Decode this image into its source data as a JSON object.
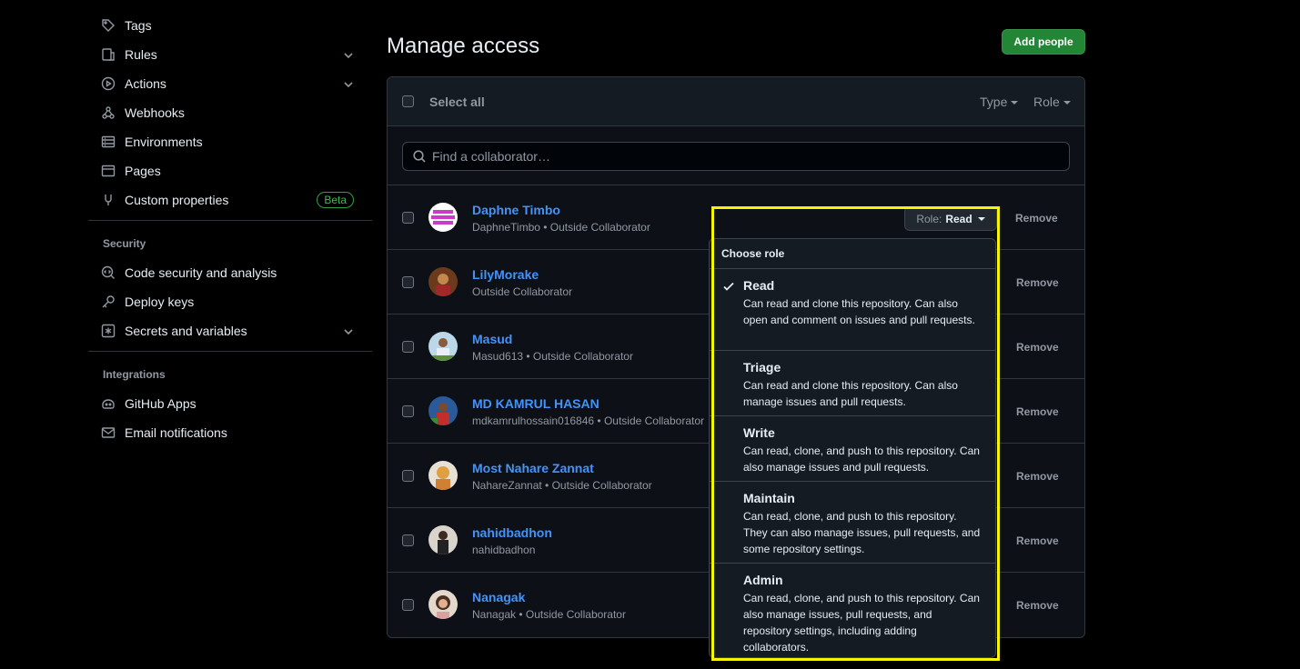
{
  "sidebar": {
    "items": [
      {
        "label": "Tags",
        "icon": "tag-icon"
      },
      {
        "label": "Rules",
        "icon": "rules-icon"
      },
      {
        "label": "Actions",
        "icon": "play-icon"
      },
      {
        "label": "Webhooks",
        "icon": "webhook-icon"
      },
      {
        "label": "Environments",
        "icon": "server-icon"
      },
      {
        "label": "Pages",
        "icon": "browser-icon"
      },
      {
        "label": "Custom properties",
        "icon": "note-icon",
        "badge": "Beta"
      }
    ],
    "security": {
      "title": "Security",
      "items": [
        {
          "label": "Code security and analysis",
          "icon": "codescan-icon"
        },
        {
          "label": "Deploy keys",
          "icon": "key-icon"
        },
        {
          "label": "Secrets and variables",
          "icon": "asterisk-icon"
        }
      ]
    },
    "integrations": {
      "title": "Integrations",
      "items": [
        {
          "label": "GitHub Apps",
          "icon": "app-icon"
        },
        {
          "label": "Email notifications",
          "icon": "mail-icon"
        }
      ]
    }
  },
  "main": {
    "title": "Manage access",
    "add_button": "Add people",
    "select_all": "Select all",
    "filters": {
      "type": "Type",
      "role": "Role"
    },
    "search_placeholder": "Find a collaborator…",
    "remove_label": "Remove",
    "collaborators": [
      {
        "name": "Daphne Timbo",
        "meta": "DaphneTimbo • Outside Collaborator"
      },
      {
        "name": "LilyMorake",
        "meta": "Outside Collaborator"
      },
      {
        "name": "Masud",
        "meta": "Masud613 • Outside Collaborator"
      },
      {
        "name": "MD KAMRUL HASAN",
        "meta": "mdkamrulhossain016846 • Outside Collaborator"
      },
      {
        "name": "Most Nahare Zannat",
        "meta": "NahareZannat • Outside Collaborator"
      },
      {
        "name": "nahidbadhon",
        "meta": "nahidbadhon"
      },
      {
        "name": "Nanagak",
        "meta": "Nanagak • Outside Collaborator"
      }
    ]
  },
  "role_menu": {
    "button_label": "Role:",
    "button_value": "Read",
    "title": "Choose role",
    "selected": "Read",
    "options": [
      {
        "name": "Read",
        "desc": "Can read and clone this repository. Can also open and comment on issues and pull requests."
      },
      {
        "name": "Triage",
        "desc": "Can read and clone this repository. Can also manage issues and pull requests."
      },
      {
        "name": "Write",
        "desc": "Can read, clone, and push to this repository. Can also manage issues and pull requests."
      },
      {
        "name": "Maintain",
        "desc": "Can read, clone, and push to this repository. They can also manage issues, pull requests, and some repository settings."
      },
      {
        "name": "Admin",
        "desc": "Can read, clone, and push to this repository. Can also manage issues, pull requests, and repository settings, including adding collaborators."
      }
    ]
  },
  "colors": {
    "highlight": "#f5f500",
    "link": "#4493f8",
    "primary_button": "#238636"
  }
}
